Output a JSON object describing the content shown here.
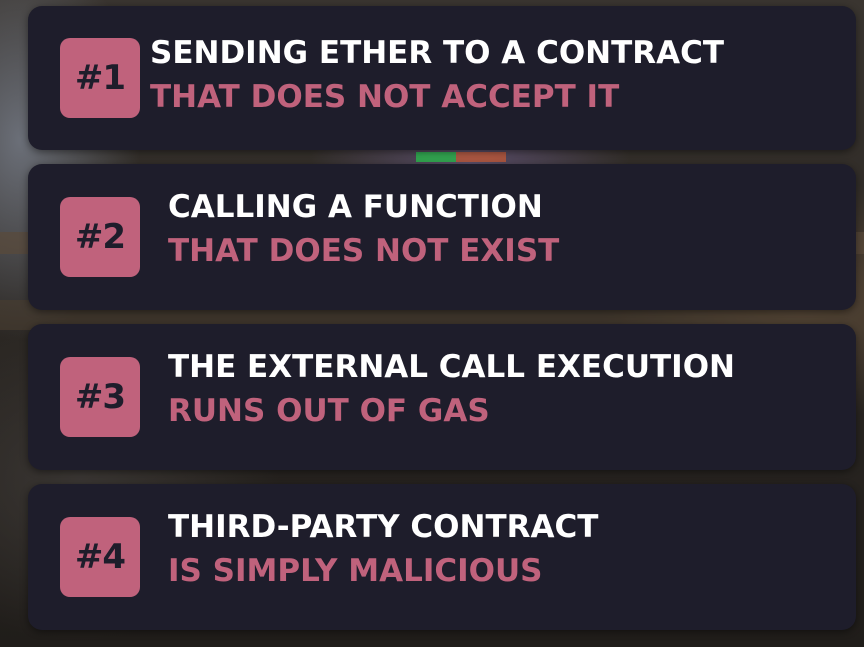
{
  "items": [
    {
      "number": "#1",
      "title": "SENDING ETHER TO A CONTRACT",
      "subtitle": "THAT DOES NOT ACCEPT IT"
    },
    {
      "number": "#2",
      "title": "CALLING A FUNCTION",
      "subtitle": "THAT DOES NOT EXIST"
    },
    {
      "number": "#3",
      "title": "THE EXTERNAL CALL EXECUTION",
      "subtitle": "RUNS OUT OF GAS"
    },
    {
      "number": "#4",
      "title": "THIRD-PARTY CONTRACT",
      "subtitle": "IS SIMPLY MALICIOUS"
    }
  ],
  "colors": {
    "card_background": "#1e1d2b",
    "accent_pink": "#c0627c",
    "title_white": "#ffffff"
  }
}
